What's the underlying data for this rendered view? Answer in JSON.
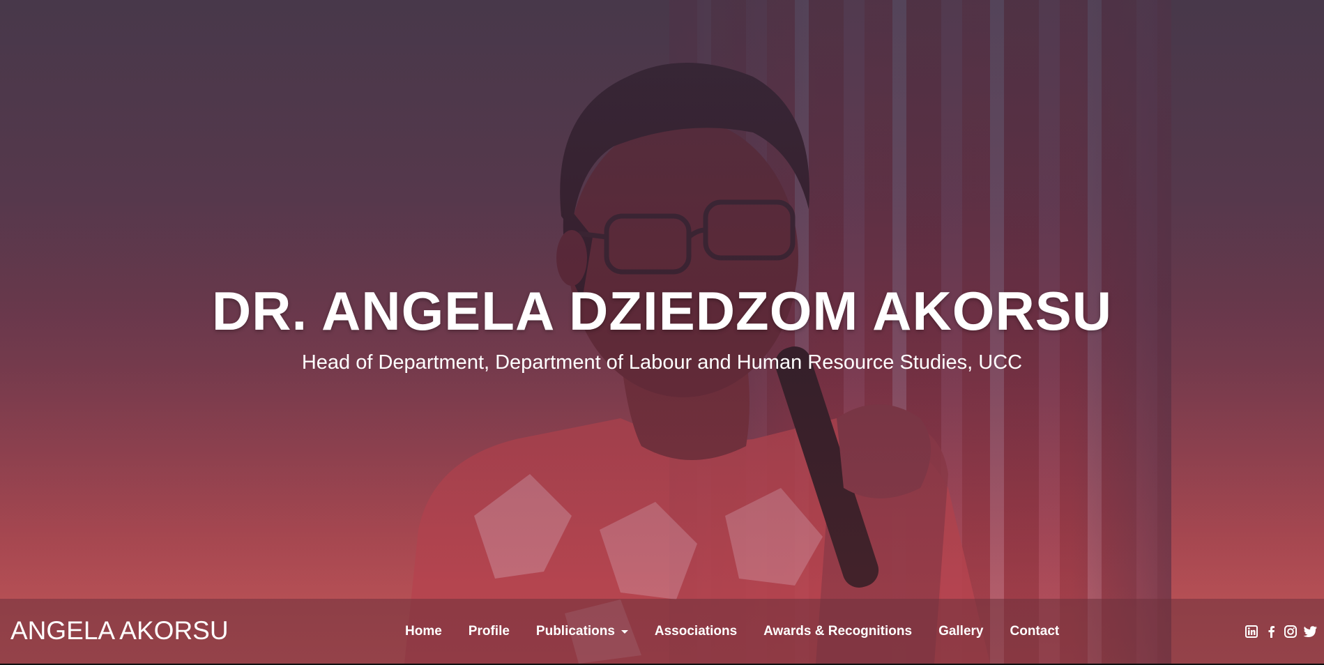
{
  "hero": {
    "title": "DR. ANGELA DZIEDZOM AKORSU",
    "subtitle": "Head of Department, Department of Labour and Human Resource Studies, UCC"
  },
  "navbar": {
    "brand": "ANGELA AKORSU",
    "items": [
      {
        "label": "Home"
      },
      {
        "label": "Profile"
      },
      {
        "label": "Publications",
        "dropdown": true
      },
      {
        "label": "Associations"
      },
      {
        "label": "Awards & Recognitions"
      },
      {
        "label": "Gallery"
      },
      {
        "label": "Contact"
      }
    ],
    "social": [
      "linkedin-icon",
      "facebook-icon",
      "instagram-icon",
      "twitter-icon"
    ]
  },
  "colors": {
    "text": "#ffffff",
    "navbar_bg": "#6e323c",
    "hero_top": "#4a3a4a",
    "hero_bottom": "#c55a5a"
  }
}
